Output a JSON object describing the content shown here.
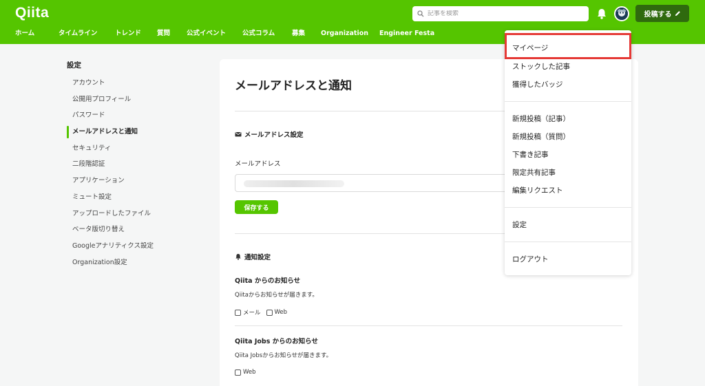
{
  "header": {
    "logo": "Qiita",
    "search_placeholder": "記事を検索",
    "post_button_label": "投稿する",
    "nav": [
      "ホーム",
      "タイムライン",
      "トレンド",
      "質問",
      "公式イベント",
      "公式コラム",
      "募集",
      "Organization",
      "Engineer Festa"
    ]
  },
  "sidebar": {
    "title": "設定",
    "items": [
      {
        "label": "アカウント"
      },
      {
        "label": "公開用プロフィール"
      },
      {
        "label": "パスワード"
      },
      {
        "label": "メールアドレスと通知",
        "active": true
      },
      {
        "label": "セキュリティ"
      },
      {
        "label": "二段階認証"
      },
      {
        "label": "アプリケーション"
      },
      {
        "label": "ミュート設定"
      },
      {
        "label": "アップロードしたファイル"
      },
      {
        "label": "ベータ版切り替え"
      },
      {
        "label": "Googleアナリティクス設定"
      },
      {
        "label": "Organization設定"
      }
    ]
  },
  "main": {
    "title": "メールアドレスと通知",
    "email_section": {
      "heading": "メールアドレス設定",
      "field_label": "メールアドレス",
      "save_label": "保存する"
    },
    "notify_section": {
      "heading": "通知設定",
      "groups": [
        {
          "title": "Qiita からのお知らせ",
          "desc": "Qiitaからお知らせが届きます。",
          "options": [
            "メール",
            "Web"
          ]
        },
        {
          "title": "Qiita Jobs からのお知らせ",
          "desc": "Qiita Jobsからお知らせが届きます。",
          "options": [
            "Web"
          ]
        }
      ]
    }
  },
  "dropdown": {
    "group1": [
      "マイページ",
      "ストックした記事",
      "獲得したバッジ"
    ],
    "group2": [
      "新規投稿（記事）",
      "新規投稿（質問）",
      "下書き記事",
      "限定共有記事",
      "編集リクエスト"
    ],
    "group3": [
      "設定"
    ],
    "group4": [
      "ログアウト"
    ]
  },
  "colors": {
    "brand": "#55c500",
    "post_button": "#2f6a0e",
    "highlight": "#e53935"
  }
}
